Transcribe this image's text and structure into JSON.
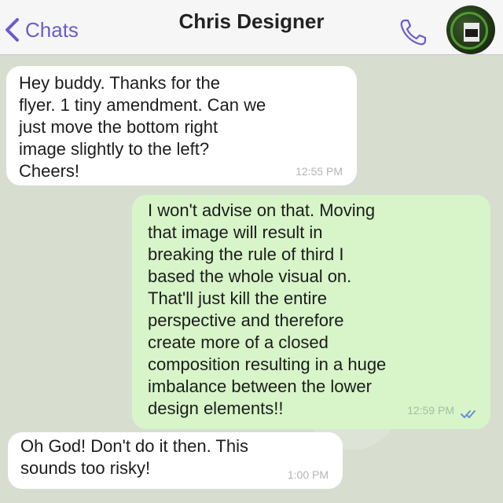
{
  "header": {
    "back_label": "Chats",
    "contact_name": "Chris Designer"
  },
  "colors": {
    "accent": "#6a5bd0",
    "incoming_bubble": "#ffffff",
    "outgoing_bubble": "#d7f5c8",
    "chat_background": "#d7ddcf"
  },
  "messages": [
    {
      "direction": "incoming",
      "text": "Hey buddy. Thanks for the\nflyer. 1 tiny amendment. Can we\njust move the bottom right\nimage slightly to the left?\nCheers!",
      "time": "12:55 PM"
    },
    {
      "direction": "outgoing",
      "text": "I won't advise on that. Moving\nthat image will result in\nbreaking the rule of third I\nbased the whole visual on.\nThat'll just kill the entire\nperspective and therefore\ncreate more of a closed\ncomposition resulting in a huge\nimbalance between the lower\ndesign elements!!",
      "time": "12:59 PM",
      "status_icon": "double-check-icon"
    },
    {
      "direction": "incoming",
      "text": "Oh God! Don't do it then. This\nsounds too risky!",
      "time": "1:00 PM"
    }
  ],
  "icons": {
    "back": "chevron-left-icon",
    "call": "phone-icon",
    "avatar": "avatar"
  }
}
